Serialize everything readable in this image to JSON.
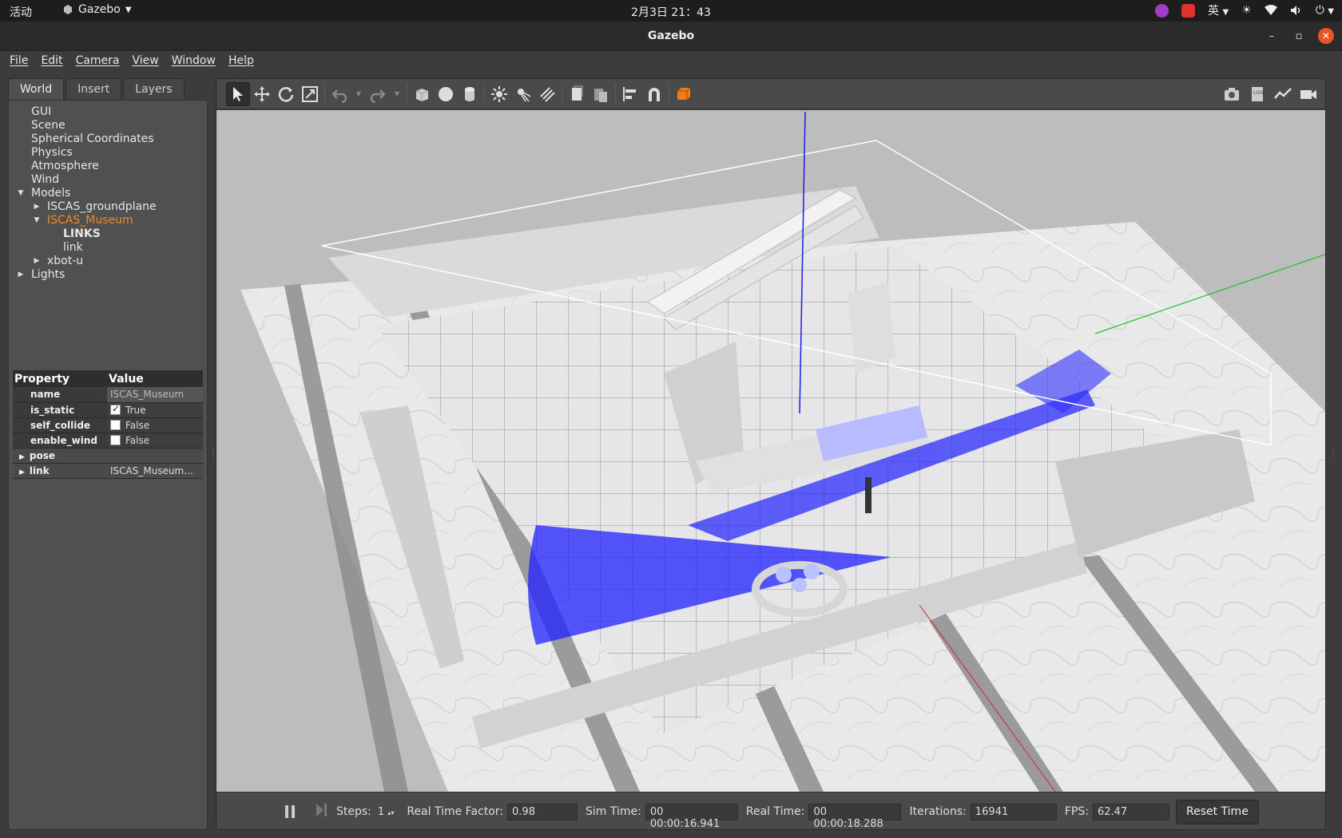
{
  "system_bar": {
    "activities": "活动",
    "app_name": "Gazebo",
    "clock": "2月3日  21：43",
    "input_method": "英"
  },
  "window": {
    "title": "Gazebo"
  },
  "menu": [
    "File",
    "Edit",
    "Camera",
    "View",
    "Window",
    "Help"
  ],
  "left_panel": {
    "tabs": [
      "World",
      "Insert",
      "Layers"
    ],
    "tree": {
      "gui": "GUI",
      "scene": "Scene",
      "spherical": "Spherical Coordinates",
      "physics": "Physics",
      "atmosphere": "Atmosphere",
      "wind": "Wind",
      "models": "Models",
      "groundplane": "ISCAS_groundplane",
      "museum": "ISCAS_Museum",
      "links": "LINKS",
      "link": "link",
      "xbot": "xbot-u",
      "lights": "Lights"
    },
    "splitter": ".....",
    "properties": {
      "header_property": "Property",
      "header_value": "Value",
      "name_key": "name",
      "name_val": "ISCAS_Museum",
      "is_static_key": "is_static",
      "is_static_val": "True",
      "is_static_checked": true,
      "self_collide_key": "self_collide",
      "self_collide_val": "False",
      "enable_wind_key": "enable_wind",
      "enable_wind_val": "False",
      "pose_key": "pose",
      "link_key": "link",
      "link_val": "ISCAS_Museum..."
    }
  },
  "toolbar": {
    "tools": [
      "select-mode",
      "translate-mode",
      "rotate-mode",
      "scale-mode",
      "undo",
      "redo",
      "box",
      "sphere",
      "cylinder",
      "point-light",
      "spot-light",
      "directional-light",
      "copy",
      "paste",
      "align",
      "snap",
      "view-angle"
    ],
    "right_tools": [
      "screenshot",
      "log",
      "plot",
      "record-video"
    ]
  },
  "status_bar": {
    "steps_label": "Steps:",
    "steps_value": "1",
    "rtf_label": "Real Time Factor:",
    "rtf_value": "0.98",
    "sim_time_label": "Sim Time:",
    "sim_time_value": "00 00:00:16.941",
    "real_time_label": "Real Time:",
    "real_time_value": "00 00:00:18.288",
    "iterations_label": "Iterations:",
    "iterations_value": "16941",
    "fps_label": "FPS:",
    "fps_value": "62.47",
    "reset_label": "Reset Time"
  },
  "colors": {
    "accent": "#e95420",
    "selected_tree": "#f08a24",
    "laser": "#2020ff"
  }
}
